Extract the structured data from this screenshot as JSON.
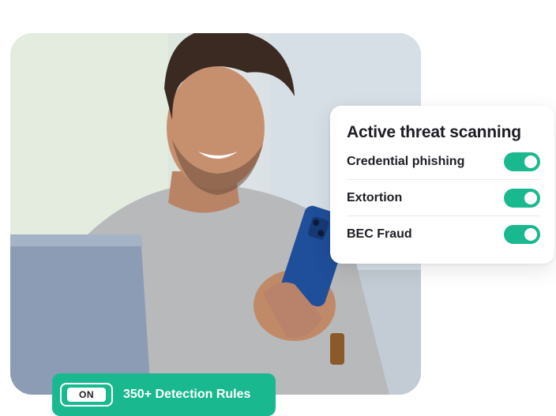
{
  "threat_card": {
    "title": "Active threat scanning",
    "items": [
      {
        "label": "Credential phishing",
        "enabled": true
      },
      {
        "label": "Extortion",
        "enabled": true
      },
      {
        "label": "BEC Fraud",
        "enabled": true
      }
    ]
  },
  "detection_badge": {
    "toggle_label": "ON",
    "text": "350+ Detection Rules"
  },
  "colors": {
    "accent": "#1ab88f",
    "text_dark": "#1c1c24",
    "card_bg": "#ffffff"
  },
  "photo": {
    "icon": "person-with-phone-photo"
  }
}
